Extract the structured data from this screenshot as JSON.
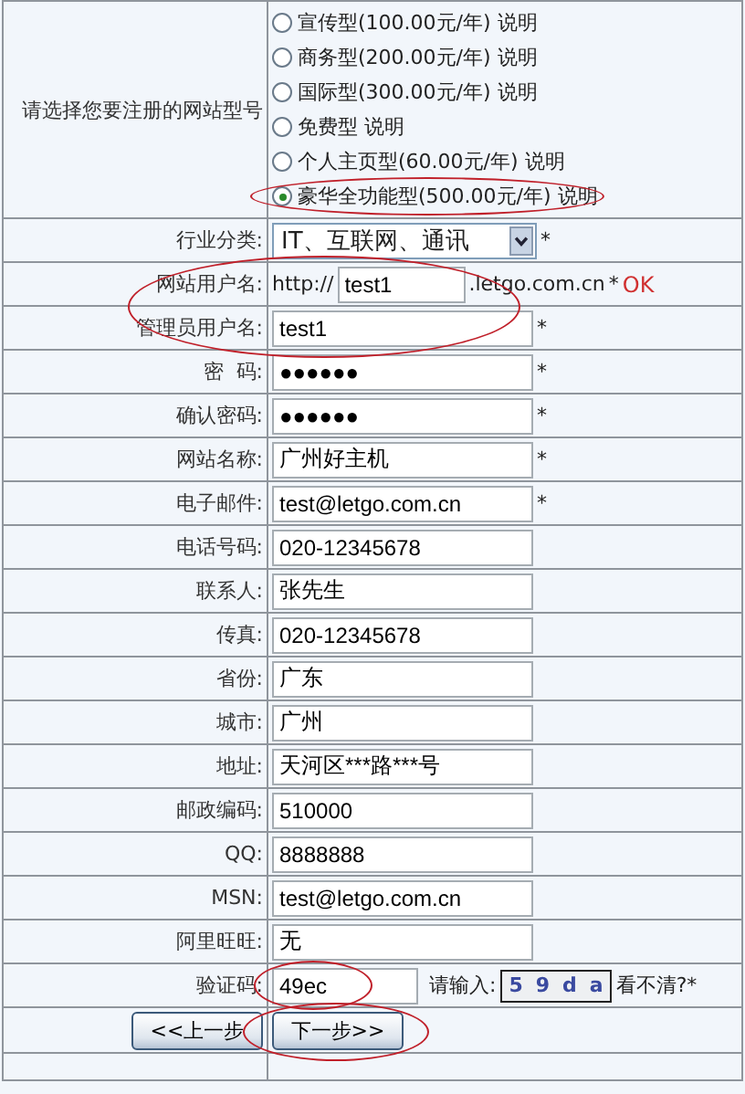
{
  "plan": {
    "label": "请选择您要注册的网站型号",
    "options": [
      {
        "text": "宣传型(100.00元/年) 说明",
        "selected": false
      },
      {
        "text": "商务型(200.00元/年) 说明",
        "selected": false
      },
      {
        "text": "国际型(300.00元/年) 说明",
        "selected": false
      },
      {
        "text": "免费型  说明",
        "selected": false
      },
      {
        "text": "个人主页型(60.00元/年) 说明",
        "selected": false
      },
      {
        "text": "豪华全功能型(500.00元/年) 说明",
        "selected": true,
        "circled": true
      }
    ]
  },
  "fields": [
    {
      "kind": "select",
      "label": "行业分类:",
      "value": "IT、互联网、通讯",
      "required": "*"
    },
    {
      "kind": "domain",
      "label": "网站用户名:",
      "prefix": "http://",
      "value": "test1",
      "suffix": ".letgo.com.cn",
      "required": "*",
      "status": "OK",
      "circled": true
    },
    {
      "kind": "text",
      "label": "管理员用户名:",
      "value": "test1",
      "required": "*"
    },
    {
      "kind": "text",
      "label": "密  码:",
      "value": "●●●●●●",
      "required": "*"
    },
    {
      "kind": "text",
      "label": "确认密码:",
      "value": "●●●●●●",
      "required": "*"
    },
    {
      "kind": "text",
      "label": "网站名称:",
      "value": "广州好主机",
      "required": "*"
    },
    {
      "kind": "text",
      "label": "电子邮件:",
      "value": "test@letgo.com.cn",
      "required": "*"
    },
    {
      "kind": "text",
      "label": "电话号码:",
      "value": "020-12345678"
    },
    {
      "kind": "text",
      "label": "联系人:",
      "value": "张先生"
    },
    {
      "kind": "text",
      "label": "传真:",
      "value": "020-12345678"
    },
    {
      "kind": "text",
      "label": "省份:",
      "value": "广东"
    },
    {
      "kind": "text",
      "label": "城市:",
      "value": "广州"
    },
    {
      "kind": "text",
      "label": "地址:",
      "value": "天河区***路***号"
    },
    {
      "kind": "text",
      "label": "邮政编码:",
      "value": "510000"
    },
    {
      "kind": "text",
      "label": "QQ:",
      "value": "8888888"
    },
    {
      "kind": "text",
      "label": "MSN:",
      "value": "test@letgo.com.cn"
    },
    {
      "kind": "text",
      "label": "阿里旺旺:",
      "value": "无"
    },
    {
      "kind": "captcha",
      "label": "验证码:",
      "value": "49ec",
      "prompt": "请输入:",
      "captcha": [
        "5",
        "9",
        "d",
        "a"
      ],
      "refresh": "看不清?*",
      "circled": true
    }
  ],
  "buttons": [
    {
      "label": "<<上一步"
    },
    {
      "label": "下一步>>",
      "circled": true
    }
  ]
}
